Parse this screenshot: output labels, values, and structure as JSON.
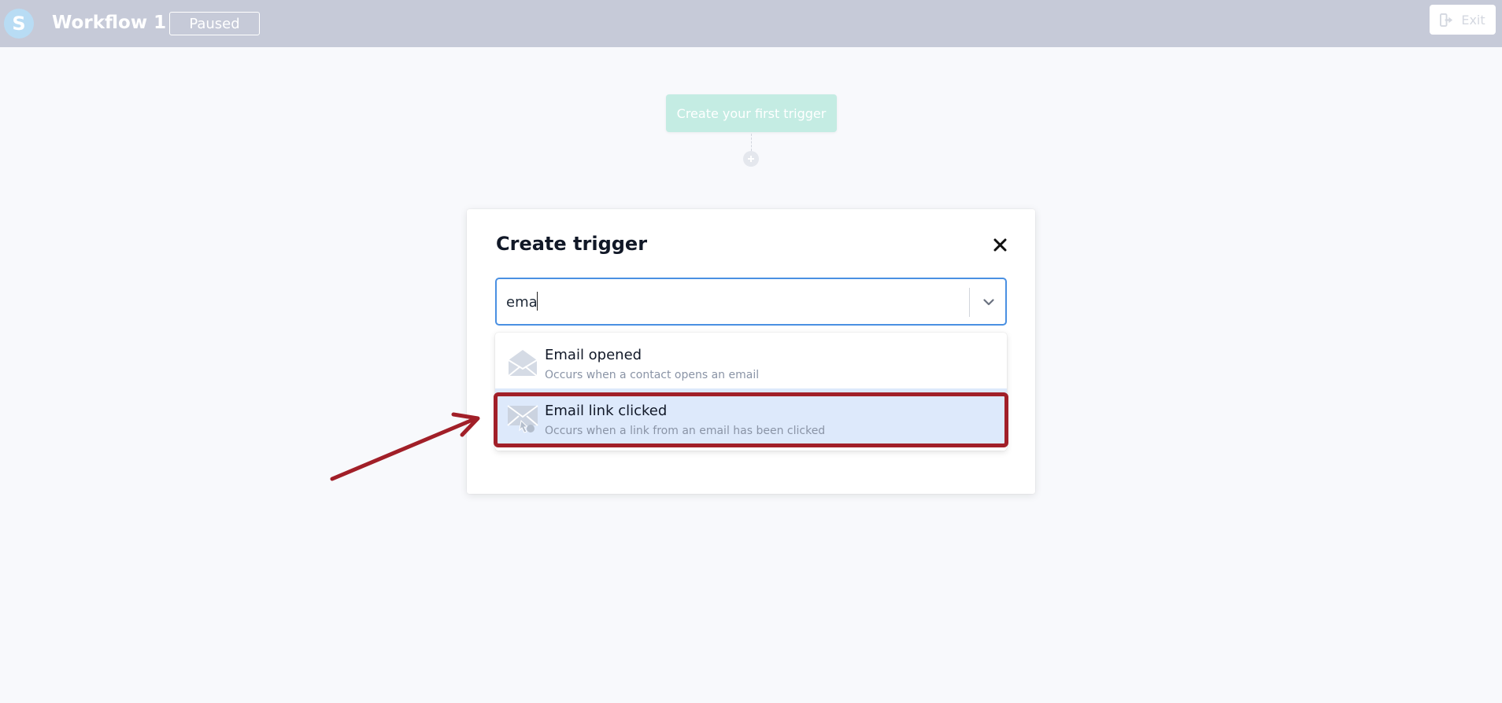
{
  "topbar": {
    "logo_letter": "S",
    "workflow_title": "Workflow 1",
    "status": "Paused",
    "exit_label": "Exit"
  },
  "canvas": {
    "trigger_node_label": "Create your first trigger"
  },
  "modal": {
    "title": "Create trigger",
    "search": {
      "value": "ema",
      "placeholder": ""
    },
    "options": [
      {
        "label": "Email opened",
        "description": "Occurs when a contact opens an email",
        "icon": "envelope-open-icon"
      },
      {
        "label": "Email link clicked",
        "description": "Occurs when a link from an email has been clicked",
        "icon": "envelope-click-icon",
        "highlighted": true
      }
    ]
  },
  "colors": {
    "topbar_bg": "#c6cad8",
    "accent_blue": "#4a90e2",
    "option_highlight": "#dde9fb",
    "annotation_red": "#a11f28",
    "trigger_node_bg": "#c4ece3"
  }
}
